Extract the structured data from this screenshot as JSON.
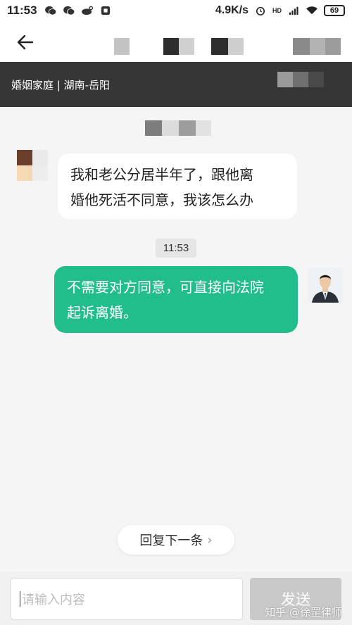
{
  "status_bar": {
    "time": "11:53",
    "network_speed": "4.9K/s",
    "battery": "69",
    "hd_label": "HD",
    "icons": [
      "wechat-icon",
      "wechat-icon",
      "weibo-icon",
      "app-icon",
      "alarm-icon",
      "signal-icon",
      "wifi-icon",
      "battery-icon"
    ]
  },
  "banner": {
    "text": "婚姻家庭 | 湖南-岳阳"
  },
  "chat": {
    "incoming_message": {
      "line1": "我和老公分居半年了，跟他离",
      "line2": "婚他死活不同意，我该怎么办"
    },
    "timestamp": "11:53",
    "outgoing_message": {
      "line1": "不需要对方同意，可直接向法院",
      "line2": "起诉离婚。"
    }
  },
  "reply_next": {
    "label": "回复下一条"
  },
  "composer": {
    "placeholder": "请输入内容",
    "send_label": "发送"
  },
  "watermark": "知乎 @徐罡律师",
  "colors": {
    "accent_green": "#22bd8c",
    "banner_bg": "#363636",
    "chat_bg": "#f5f5f5"
  }
}
